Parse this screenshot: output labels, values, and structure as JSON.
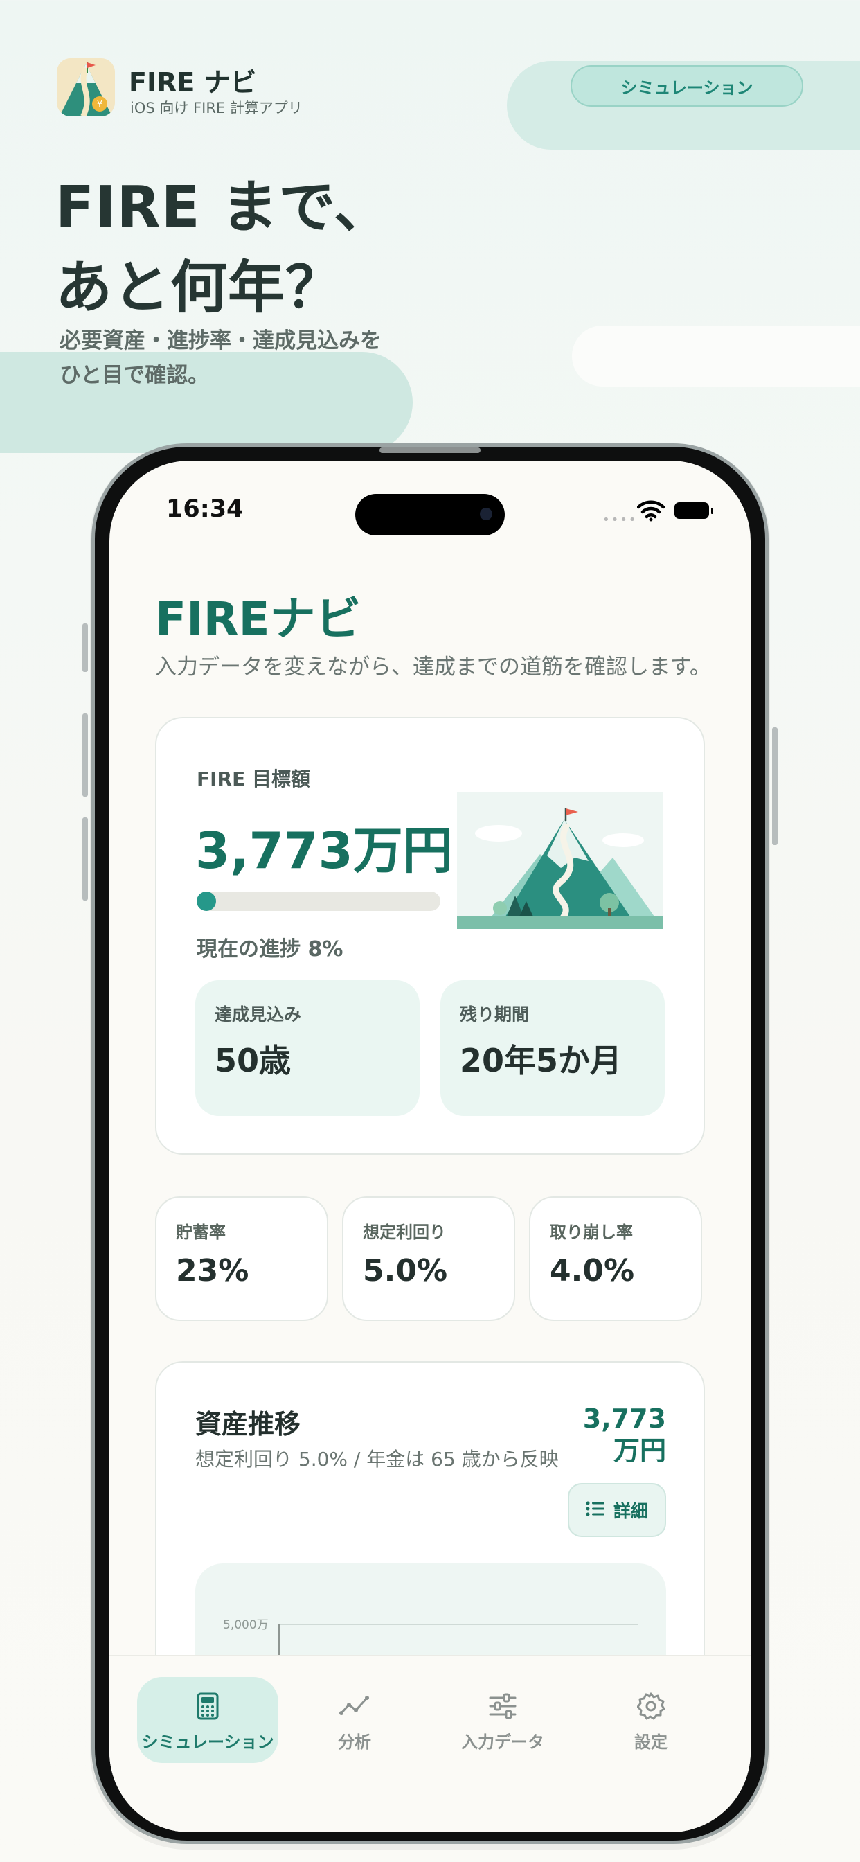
{
  "brand": {
    "name": "FIRE ナビ",
    "subtitle": "iOS 向け FIRE 計算アプリ"
  },
  "promo": {
    "pill_label": "シミュレーション",
    "headline_line1": "FIRE まで、",
    "headline_line2": "あと何年？",
    "subcopy_line1": "必要資産・進捗率・達成見込みを",
    "subcopy_line2": "ひと目で確認。"
  },
  "status_bar": {
    "time": "16:34",
    "signal": "••••"
  },
  "app": {
    "title": "FIREナビ",
    "subtitle": "入力データを変えながら、達成までの道筋を確認します。"
  },
  "goal_card": {
    "label": "FIRE 目標額",
    "value": "3,773万円",
    "progress_percent": 8,
    "progress_text": "現在の進捗 8%",
    "eta_label": "達成見込み",
    "eta_value": "50歳",
    "remaining_label": "残り期間",
    "remaining_value": "20年5か月"
  },
  "metrics": [
    {
      "label": "貯蓄率",
      "value": "23%"
    },
    {
      "label": "想定利回り",
      "value": "5.0%"
    },
    {
      "label": "取り崩し率",
      "value": "4.0%"
    }
  ],
  "trend_card": {
    "title": "資産推移",
    "subtitle": "想定利回り 5.0% / 年金は 65 歳から反映",
    "amount_line1": "3,773",
    "amount_line2": "万円",
    "detail_button": "詳細",
    "y_tick_top": "5,000万"
  },
  "tabs": [
    {
      "label": "シミュレーション",
      "icon": "calculator-icon",
      "active": true
    },
    {
      "label": "分析",
      "icon": "chart-line-icon",
      "active": false
    },
    {
      "label": "入力データ",
      "icon": "sliders-icon",
      "active": false
    },
    {
      "label": "設定",
      "icon": "gear-icon",
      "active": false
    }
  ],
  "colors": {
    "accent": "#17705f",
    "progress": "#26988a",
    "tab_active_bg": "#d6efe8"
  }
}
